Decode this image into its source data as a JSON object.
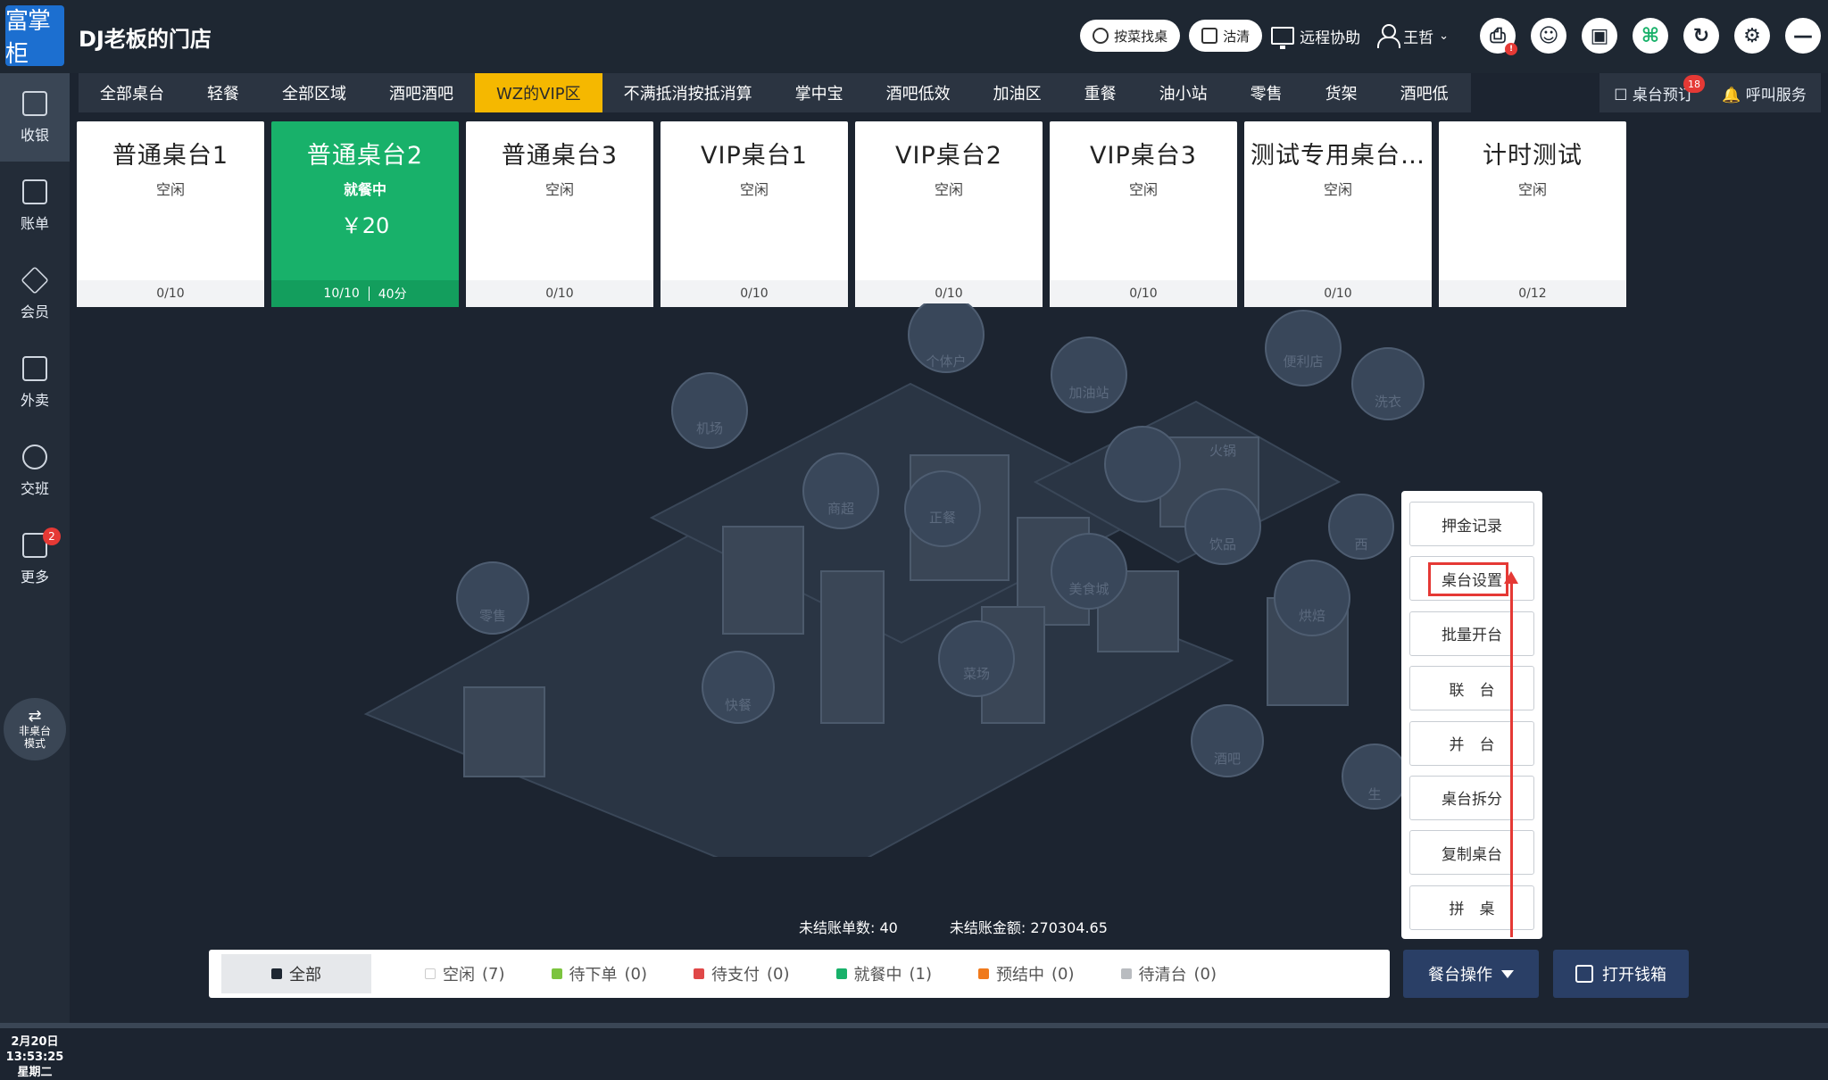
{
  "app": {
    "logo_text": "富掌柜",
    "store_name": "DJ老板的门店"
  },
  "topbar": {
    "search_dish": "按菜找桌",
    "clean": "沽清",
    "remote_help": "远程协助",
    "user": "王哲"
  },
  "sidebar": {
    "items": [
      {
        "label": "收银"
      },
      {
        "label": "账单"
      },
      {
        "label": "会员"
      },
      {
        "label": "外卖"
      },
      {
        "label": "交班"
      },
      {
        "label": "更多",
        "badge": "2"
      }
    ],
    "mode_line1": "非桌台",
    "mode_line2": "模式",
    "date": "2月20日",
    "time": "13:53:25",
    "weekday": "星期二"
  },
  "area_tabs": [
    "全部桌台",
    "轻餐",
    "全部区域",
    "酒吧酒吧",
    "WZ的VIP区",
    "不满抵消按抵消算",
    "掌中宝",
    "酒吧低效",
    "加油区",
    "重餐",
    "油小站",
    "零售",
    "货架",
    "酒吧低"
  ],
  "top_actions": {
    "reserve": "桌台预订",
    "reserve_badge": "18",
    "call_service": "呼叫服务"
  },
  "tables": [
    {
      "name": "普通桌台1",
      "status": "空闲",
      "seats": "0/10"
    },
    {
      "name": "普通桌台2",
      "status": "就餐中",
      "amount": "￥20",
      "seats": "10/10",
      "duration": "40分"
    },
    {
      "name": "普通桌台3",
      "status": "空闲",
      "seats": "0/10"
    },
    {
      "name": "VIP桌台1",
      "status": "空闲",
      "seats": "0/10"
    },
    {
      "name": "VIP桌台2",
      "status": "空闲",
      "seats": "0/10"
    },
    {
      "name": "VIP桌台3",
      "status": "空闲",
      "seats": "0/10"
    },
    {
      "name": "测试专用桌台…",
      "status": "空闲",
      "seats": "0/10"
    },
    {
      "name": "计时测试",
      "status": "空闲",
      "seats": "0/12"
    }
  ],
  "city_labels": [
    "个体户",
    "便利店",
    "加油站",
    "洗衣",
    "机场",
    "饮品",
    "商超",
    "正餐",
    "火锅",
    "西",
    "美食城",
    "烘焙",
    "零售",
    "菜场",
    "快餐",
    "酒吧",
    "生"
  ],
  "context_menu": [
    "押金记录",
    "桌台设置",
    "批量开台",
    "联　台",
    "并　台",
    "桌台拆分",
    "复制桌台",
    "拼　桌"
  ],
  "summary": {
    "unsettled_count_label": "未结账单数:",
    "unsettled_count": "40",
    "unsettled_amount_label": "未结账金额:",
    "unsettled_amount": "270304.65"
  },
  "status_filters": [
    {
      "label": "全部",
      "count": "",
      "color": "#1e2732"
    },
    {
      "label": "空闲",
      "count": "(7)",
      "color": "#ffffff"
    },
    {
      "label": "待下单",
      "count": "(0)",
      "color": "#7cc43f"
    },
    {
      "label": "待支付",
      "count": "(0)",
      "color": "#e04848"
    },
    {
      "label": "就餐中",
      "count": "(1)",
      "color": "#18b16a"
    },
    {
      "label": "预结中",
      "count": "(0)",
      "color": "#f07a1c"
    },
    {
      "label": "待清台",
      "count": "(0)",
      "color": "#b9bcc0"
    }
  ],
  "buttons": {
    "table_ops": "餐台操作",
    "open_cash": "打开钱箱"
  },
  "colors": {
    "accent": "#f5b800",
    "busy": "#18b16a",
    "highlight": "#e53935"
  }
}
